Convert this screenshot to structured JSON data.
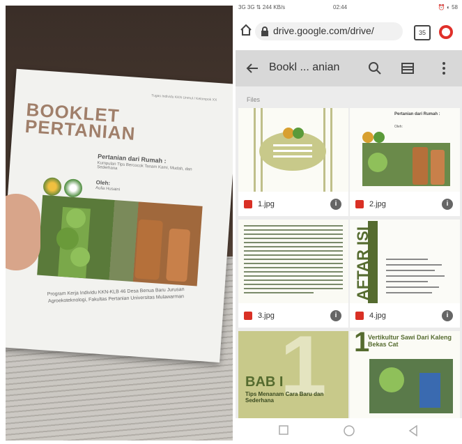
{
  "photo": {
    "booklet_header": "Tugas Individu KKN Unmul / Kelompok XX",
    "title": "BOOKLET PERTANIAN",
    "subtitle": "Pertanian dari Rumah :",
    "subtitle_desc": "Kumpulan Tips Bercocok Tanam Kami, Mudah, dan Sederhana",
    "author_label": "Oleh:",
    "author": "Aulia Husaini",
    "footer": "Program Kerja Individu KKN-KLB 46 Desa Benua Baru Jurusan Agroekoteknologi, Fakultas Pertanian Universitas Mulawarman"
  },
  "status": {
    "left": "3G 3G ⇅ 244 KB/s",
    "time": "02:44",
    "right": "⏰ ◐ 58"
  },
  "browser": {
    "url": "drive.google.com/drive/",
    "tab_count": "35"
  },
  "drive": {
    "title": "Bookl ... anian",
    "section": "Files",
    "files": [
      {
        "name": "1.jpg"
      },
      {
        "name": "2.jpg"
      },
      {
        "name": "3.jpg"
      },
      {
        "name": "4.jpg"
      },
      {
        "name": ""
      },
      {
        "name": ""
      }
    ]
  },
  "thumbs": {
    "t2_title": "Pertanian dari Rumah :",
    "t2_author": "Oleh:",
    "t4_heading": "AFTAR ISI",
    "t5_num": "1",
    "t5_bab": "BAB I",
    "t5_sub": "Tips Menanam Cara Baru dan Sederhana",
    "t6_num": "1",
    "t6_title": "Vertikultur Sawi Dari Kaleng Bekas Cat"
  },
  "colors": {
    "accent_red": "#d93025",
    "olive": "#c8c98a",
    "dark_green": "#556b2f"
  }
}
